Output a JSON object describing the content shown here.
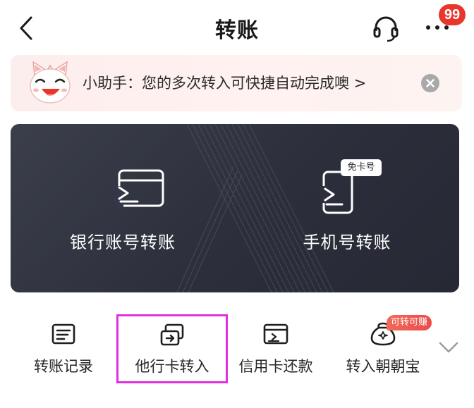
{
  "header": {
    "title": "转账",
    "message_badge": "99",
    "icons": {
      "back": "chevron-left-icon",
      "service": "headset-icon",
      "more": "more-dots-icon"
    }
  },
  "assistant": {
    "text": "小助手：您的多次转入可快捷自动完成噢 >",
    "mascot_icon": "cat-mascot-icon",
    "close_icon": "close-circle-icon"
  },
  "transfer_card": {
    "options": [
      {
        "label": "银行账号转账",
        "icon": "bank-card-transfer-icon"
      },
      {
        "label": "手机号转账",
        "icon": "phone-transfer-icon",
        "tag": "免卡号"
      }
    ]
  },
  "quick_entries": {
    "items": [
      {
        "label": "转账记录",
        "icon": "record-list-icon"
      },
      {
        "label": "他行卡转入",
        "icon": "card-transfer-in-icon",
        "selected": true
      },
      {
        "label": "信用卡还款",
        "icon": "credit-card-icon"
      },
      {
        "label": "转入朝朝宝",
        "icon": "money-bag-icon",
        "tag": "可转可赚"
      }
    ],
    "expand_icon": "chevron-down-icon"
  },
  "colors": {
    "brand_red": "#e8362c",
    "card_dark": "#2e313d",
    "highlight": "#e02fe0",
    "banner_bg": "#fdeeee"
  }
}
